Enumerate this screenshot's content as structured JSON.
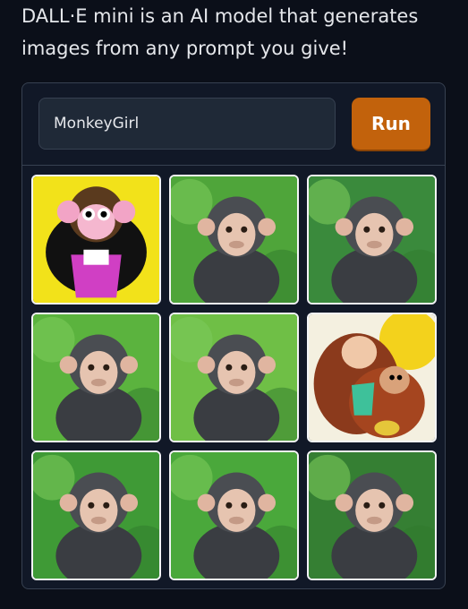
{
  "intro": {
    "text": "DALL·E mini is an AI model that generates images from any prompt you give!"
  },
  "prompt": {
    "value": "MonkeyGirl",
    "placeholder": ""
  },
  "run_button": {
    "label": "Run"
  },
  "colors": {
    "accent": "#c2620c",
    "background": "#0b0f19",
    "panel": "#111827",
    "border": "#374151"
  },
  "results": [
    {
      "subject": "cartoon monkey girl in pink dress",
      "bg": "#f2e21a",
      "style": "cartoon1"
    },
    {
      "subject": "monkey sitting, jungle background",
      "bg": "#4fa53a",
      "style": "photo"
    },
    {
      "subject": "monkey close-up, jungle background",
      "bg": "#3a8a3c",
      "style": "photo"
    },
    {
      "subject": "young monkey, jungle background",
      "bg": "#5bb33e",
      "style": "photo"
    },
    {
      "subject": "monkey sitting on grass",
      "bg": "#6fbf46",
      "style": "photo"
    },
    {
      "subject": "cartoon monkey hugging a girl",
      "bg": "#f4f0e0",
      "style": "cartoon2"
    },
    {
      "subject": "monkey sitting, jungle background",
      "bg": "#3f9a36",
      "style": "photo"
    },
    {
      "subject": "monkey sitting on rock",
      "bg": "#4aa83b",
      "style": "photo"
    },
    {
      "subject": "monkey portrait, jungle background",
      "bg": "#357f33",
      "style": "photo"
    }
  ]
}
